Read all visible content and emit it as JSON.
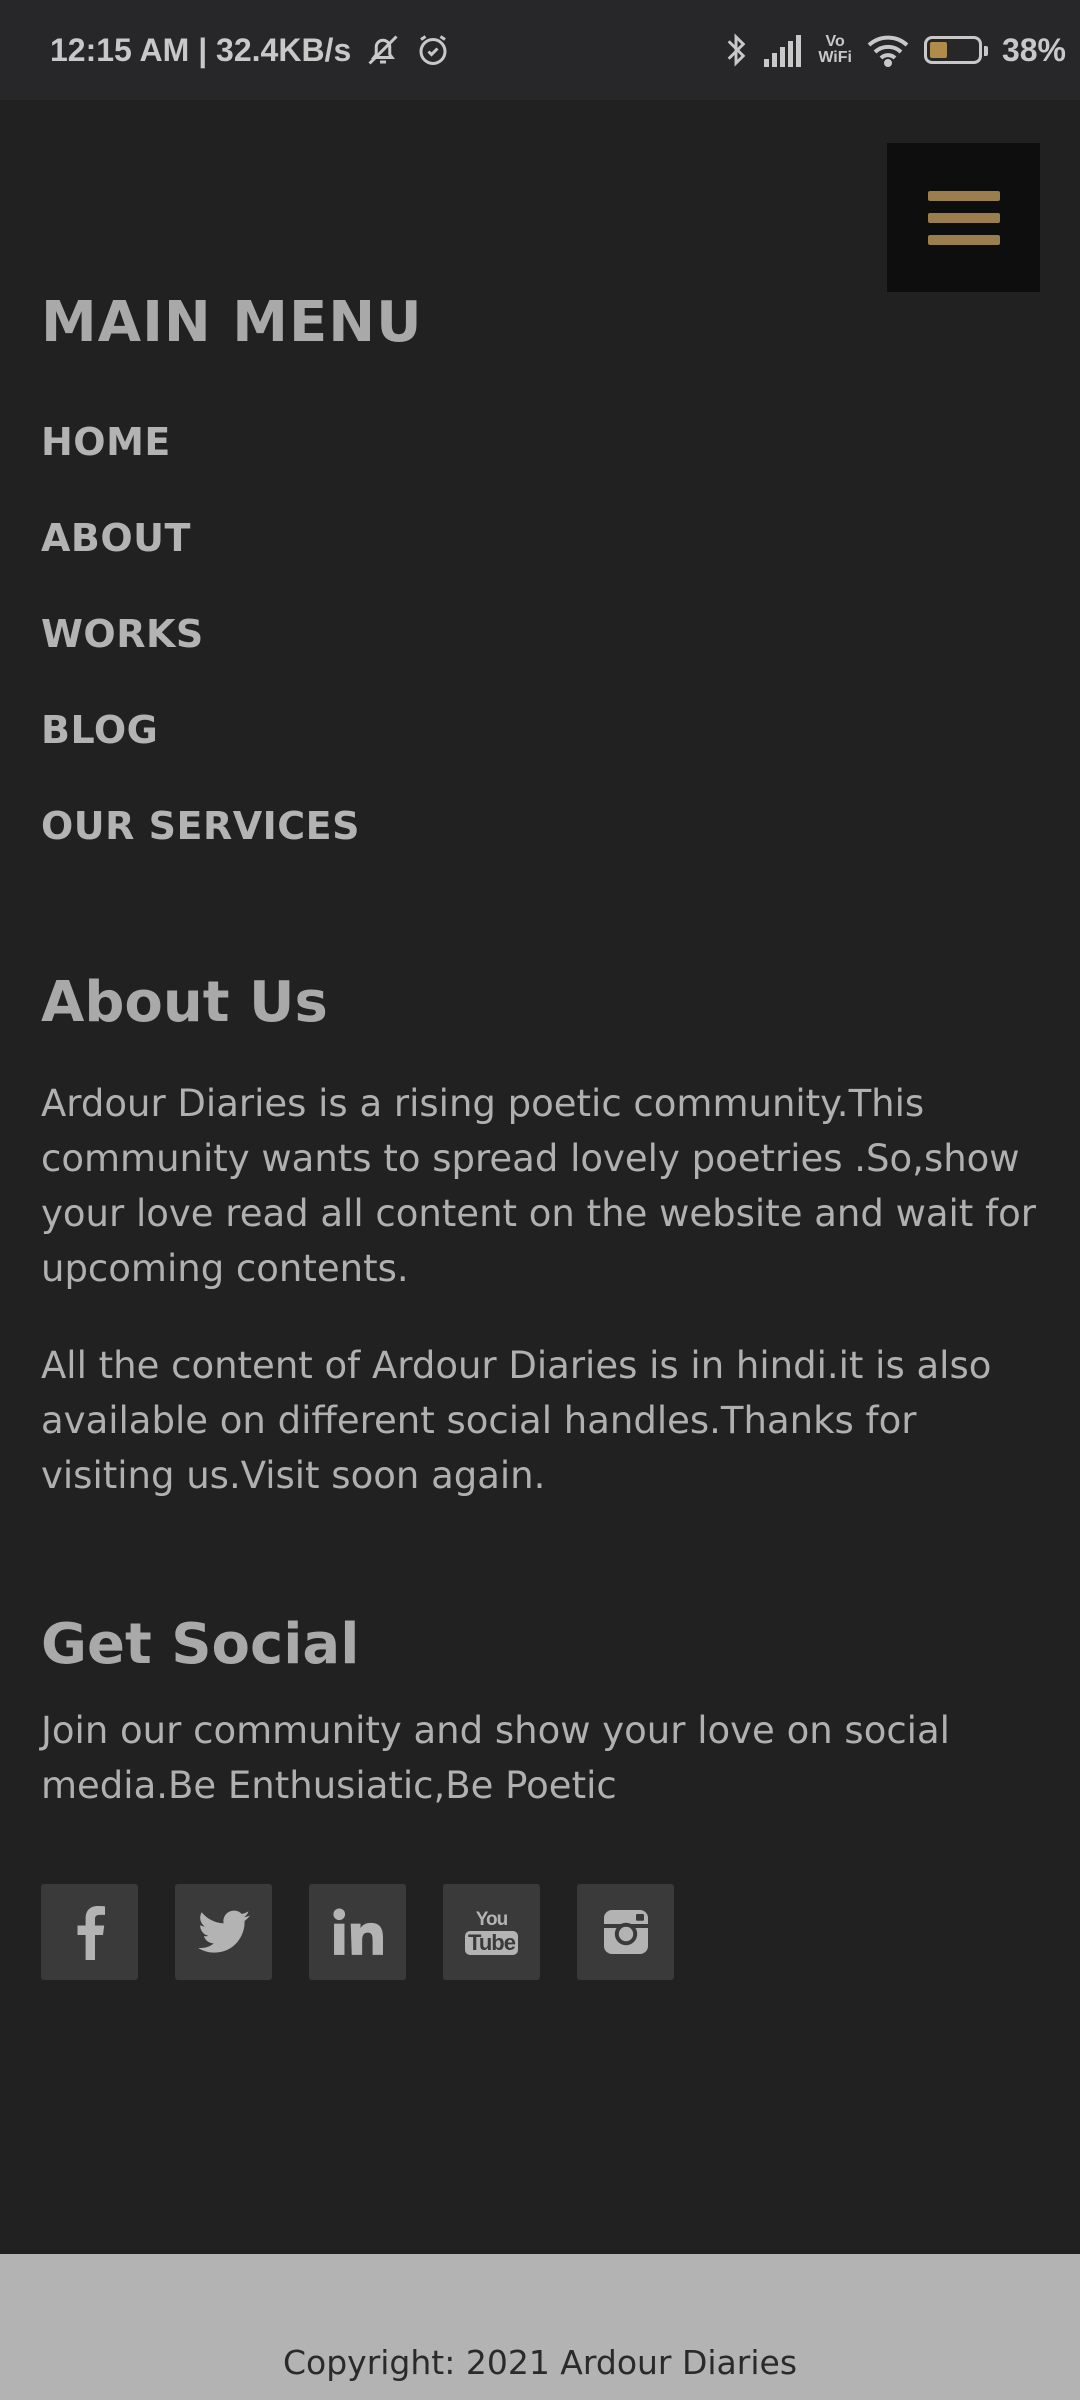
{
  "status_bar": {
    "time_speed": "12:15 AM | 32.4KB/s",
    "vowifi_top": "Vo",
    "vowifi_bottom": "WiFi",
    "battery": "38%",
    "battery_level": 0.38,
    "battery_color": "#b08b4a",
    "icons": [
      "muted-bell-icon",
      "alarm-icon",
      "bluetooth-icon",
      "signal-icon",
      "vowifi-icon",
      "wifi-icon",
      "battery-icon"
    ]
  },
  "menu_toggle": {
    "icon": "hamburger-icon",
    "color": "#9b7e4e"
  },
  "main_menu": {
    "title": "MAIN MENU",
    "items": [
      "HOME",
      "ABOUT",
      "WORKS",
      "BLOG",
      "OUR SERVICES"
    ]
  },
  "about": {
    "title": "About Us",
    "paragraph1": "Ardour Diaries is a rising poetic community.This community wants to spread lovely poetries .So,show your love read all content on the website and wait for upcoming contents.",
    "paragraph2": "All the content of Ardour Diaries is in hindi.it is also available on different social handles.Thanks for visiting us.Visit soon again."
  },
  "social": {
    "title": "Get Social",
    "text": "Join our community and show your love on social media.Be Enthusiatic,Be Poetic",
    "youtube_top": "You",
    "youtube_bottom": "Tube",
    "buttons": [
      "facebook-icon",
      "twitter-icon",
      "linkedin-icon",
      "youtube-icon",
      "instagram-icon"
    ]
  },
  "footer": {
    "copyright": "Copyright: 2021 Ardour Diaries"
  }
}
